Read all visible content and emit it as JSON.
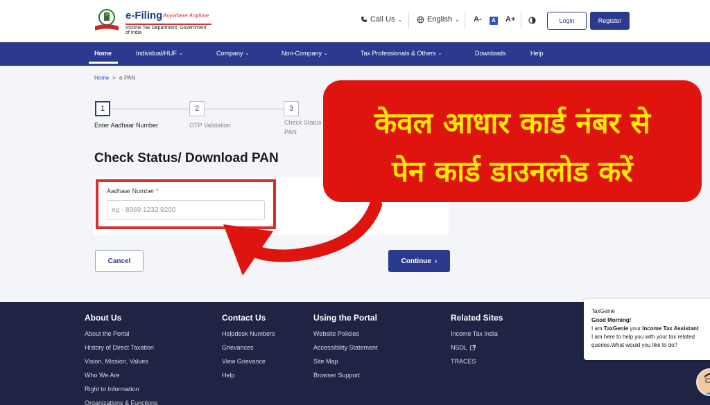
{
  "header": {
    "logo_title": "e-Filing",
    "logo_tagline": "Anywhere Anytime",
    "logo_subtitle": "Income Tax Department, Government of India",
    "call_us": "Call Us",
    "language": "English",
    "font_decrease": "A-",
    "font_normal": "A",
    "font_increase": "A+",
    "login": "Login",
    "register": "Register"
  },
  "nav": [
    {
      "label": "Home",
      "dropdown": false
    },
    {
      "label": "Individual/HUF",
      "dropdown": true
    },
    {
      "label": "Company",
      "dropdown": true
    },
    {
      "label": "Non-Company",
      "dropdown": true
    },
    {
      "label": "Tax Professionals & Others",
      "dropdown": true
    },
    {
      "label": "Downloads",
      "dropdown": false
    },
    {
      "label": "Help",
      "dropdown": false
    }
  ],
  "breadcrumb": {
    "home": "Home",
    "sep": ">",
    "current": "e-PAN"
  },
  "steps": [
    {
      "number": "1",
      "label": "Enter Aadhaar Number"
    },
    {
      "number": "2",
      "label": "OTP Validation"
    },
    {
      "number": "3",
      "label_line1": "Check Status",
      "label_line2": "PAN"
    }
  ],
  "page_title": "Check Status/ Download PAN",
  "form": {
    "label": "Aadhaar Number",
    "required_mark": "*",
    "placeholder": "eg - 8969 1232 9200",
    "value": ""
  },
  "buttons": {
    "cancel": "Cancel",
    "continue": "Continue"
  },
  "banner": {
    "line1": "केवल आधार कार्ड नंबर से",
    "line2": "पेन कार्ड डाउनलोड करें"
  },
  "footer": {
    "columns": [
      {
        "title": "About Us",
        "links": [
          "About the Portal",
          "History of Direct Taxation",
          "Vision, Mission, Values",
          "Who We Are",
          "Right to Information",
          "Organizations & Functions"
        ]
      },
      {
        "title": "Contact Us",
        "links": [
          "Helpdesk Numbers",
          "Grievances",
          "View Grievance",
          "Help"
        ]
      },
      {
        "title": "Using the Portal",
        "links": [
          "Website Policies",
          "Accessibility Statement",
          "Site Map",
          "Browser Support"
        ]
      },
      {
        "title": "Related Sites",
        "links": [
          "Income Tax India",
          "NSDL",
          "TRACES"
        ]
      }
    ]
  },
  "chat": {
    "title": "TaxGenie",
    "greeting": "Good Morning!",
    "line1_pre": "I am ",
    "line1_name": "TaxGenie",
    "line1_mid": " your ",
    "line1_role": "Income Tax Assistant",
    "line2": "I am here to help you with your tax related",
    "line3": "queries.What would you like to do?"
  },
  "colors": {
    "brand": "#2b3a8e",
    "footer": "#1f2445",
    "banner_bg": "#e0140f",
    "banner_text": "#ffe800",
    "highlight": "#e02b2b"
  }
}
